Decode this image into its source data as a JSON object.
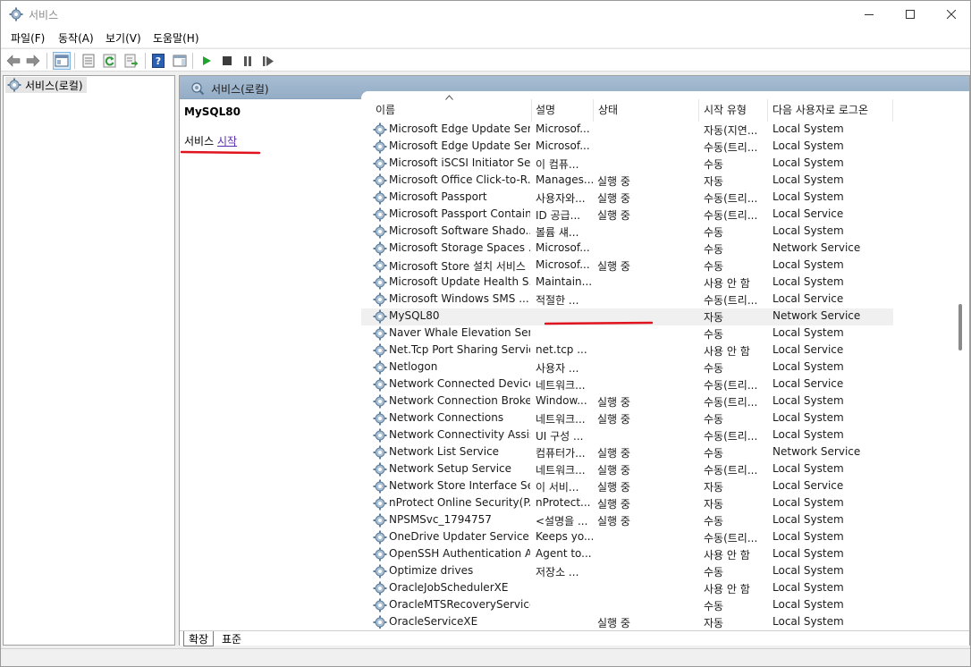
{
  "window": {
    "title": "서비스",
    "controls": {
      "minimize": "minimize-icon",
      "maximize": "maximize-icon",
      "close": "close-icon"
    }
  },
  "menu": [
    "파일(F)",
    "동작(A)",
    "보기(V)",
    "도움말(H)"
  ],
  "toolbar": {
    "icons": [
      "back-icon",
      "forward-icon",
      "show-hide-console-tree-icon",
      "properties-icon",
      "refresh-icon",
      "export-list-icon",
      "help-icon",
      "show-hide-action-pane-icon",
      "start-service-icon",
      "stop-service-icon",
      "pause-service-icon",
      "restart-service-icon"
    ]
  },
  "tree": {
    "root_label": "서비스(로컬)"
  },
  "content": {
    "header_title": "서비스(로컬)",
    "selected_service_name": "MySQL80",
    "start_prefix": "서비스",
    "start_link": "시작",
    "annotation_color": "#e0141e"
  },
  "grid": {
    "columns": [
      "이름",
      "설명",
      "상태",
      "시작 유형",
      "다음 사용자로 로그온"
    ],
    "rows": [
      {
        "name": "Microsoft Edge Update Ser...",
        "desc": "Microsof...",
        "status": "",
        "startup": "자동(지연...",
        "logon": "Local System"
      },
      {
        "name": "Microsoft Edge Update Ser...",
        "desc": "Microsof...",
        "status": "",
        "startup": "수동(트리...",
        "logon": "Local System"
      },
      {
        "name": "Microsoft iSCSI Initiator Se...",
        "desc": "이 컴퓨...",
        "status": "",
        "startup": "수동",
        "logon": "Local System"
      },
      {
        "name": "Microsoft Office Click-to-R...",
        "desc": "Manages...",
        "status": "실행 중",
        "startup": "자동",
        "logon": "Local System"
      },
      {
        "name": "Microsoft Passport",
        "desc": "사용자와...",
        "status": "실행 중",
        "startup": "수동(트리...",
        "logon": "Local System"
      },
      {
        "name": "Microsoft Passport Container",
        "desc": "ID 공급...",
        "status": "실행 중",
        "startup": "수동(트리...",
        "logon": "Local Service"
      },
      {
        "name": "Microsoft Software Shado...",
        "desc": "볼륨 섀...",
        "status": "",
        "startup": "수동",
        "logon": "Local System"
      },
      {
        "name": "Microsoft Storage Spaces ...",
        "desc": "Microsof...",
        "status": "",
        "startup": "수동",
        "logon": "Network Service"
      },
      {
        "name": "Microsoft Store 설치 서비스",
        "desc": "Microsof...",
        "status": "실행 중",
        "startup": "수동",
        "logon": "Local System"
      },
      {
        "name": "Microsoft Update Health S...",
        "desc": "Maintain...",
        "status": "",
        "startup": "사용 안 함",
        "logon": "Local System"
      },
      {
        "name": "Microsoft Windows SMS ...",
        "desc": "적절한 ...",
        "status": "",
        "startup": "수동(트리...",
        "logon": "Local Service"
      },
      {
        "name": "MySQL80",
        "desc": "",
        "status": "",
        "startup": "자동",
        "logon": "Network Service",
        "selected": true
      },
      {
        "name": "Naver Whale Elevation Serv...",
        "desc": "",
        "status": "",
        "startup": "수동",
        "logon": "Local System"
      },
      {
        "name": "Net.Tcp Port Sharing Service",
        "desc": "net.tcp ...",
        "status": "",
        "startup": "사용 안 함",
        "logon": "Local Service"
      },
      {
        "name": "Netlogon",
        "desc": "사용자 ...",
        "status": "",
        "startup": "수동",
        "logon": "Local System"
      },
      {
        "name": "Network Connected Device...",
        "desc": "네트워크...",
        "status": "",
        "startup": "수동(트리...",
        "logon": "Local Service"
      },
      {
        "name": "Network Connection Broker",
        "desc": "Window...",
        "status": "실행 중",
        "startup": "수동(트리...",
        "logon": "Local System"
      },
      {
        "name": "Network Connections",
        "desc": "네트워크...",
        "status": "실행 중",
        "startup": "수동",
        "logon": "Local System"
      },
      {
        "name": "Network Connectivity Assis...",
        "desc": "UI 구성 ...",
        "status": "",
        "startup": "수동(트리...",
        "logon": "Local System"
      },
      {
        "name": "Network List Service",
        "desc": "컴퓨터가...",
        "status": "실행 중",
        "startup": "수동",
        "logon": "Network Service"
      },
      {
        "name": "Network Setup Service",
        "desc": "네트워크...",
        "status": "실행 중",
        "startup": "수동(트리...",
        "logon": "Local System"
      },
      {
        "name": "Network Store Interface Se...",
        "desc": "이 서비...",
        "status": "실행 중",
        "startup": "자동",
        "logon": "Local Service"
      },
      {
        "name": "nProtect Online Security(P...",
        "desc": "nProtect...",
        "status": "실행 중",
        "startup": "자동",
        "logon": "Local System"
      },
      {
        "name": "NPSMSvc_1794757",
        "desc": "<설명을 ...",
        "status": "실행 중",
        "startup": "수동",
        "logon": "Local System"
      },
      {
        "name": "OneDrive Updater Service",
        "desc": "Keeps yo...",
        "status": "",
        "startup": "수동(트리...",
        "logon": "Local System"
      },
      {
        "name": "OpenSSH Authentication A...",
        "desc": "Agent to...",
        "status": "",
        "startup": "사용 안 함",
        "logon": "Local System"
      },
      {
        "name": "Optimize drives",
        "desc": "저장소 ...",
        "status": "",
        "startup": "수동",
        "logon": "Local System"
      },
      {
        "name": "OracleJobSchedulerXE",
        "desc": "",
        "status": "",
        "startup": "사용 안 함",
        "logon": "Local System"
      },
      {
        "name": "OracleMTSRecoveryService",
        "desc": "",
        "status": "",
        "startup": "수동",
        "logon": "Local System"
      },
      {
        "name": "OracleServiceXE",
        "desc": "",
        "status": "실행 중",
        "startup": "자동",
        "logon": "Local System"
      }
    ]
  },
  "tabs": [
    "확장",
    "표준"
  ]
}
